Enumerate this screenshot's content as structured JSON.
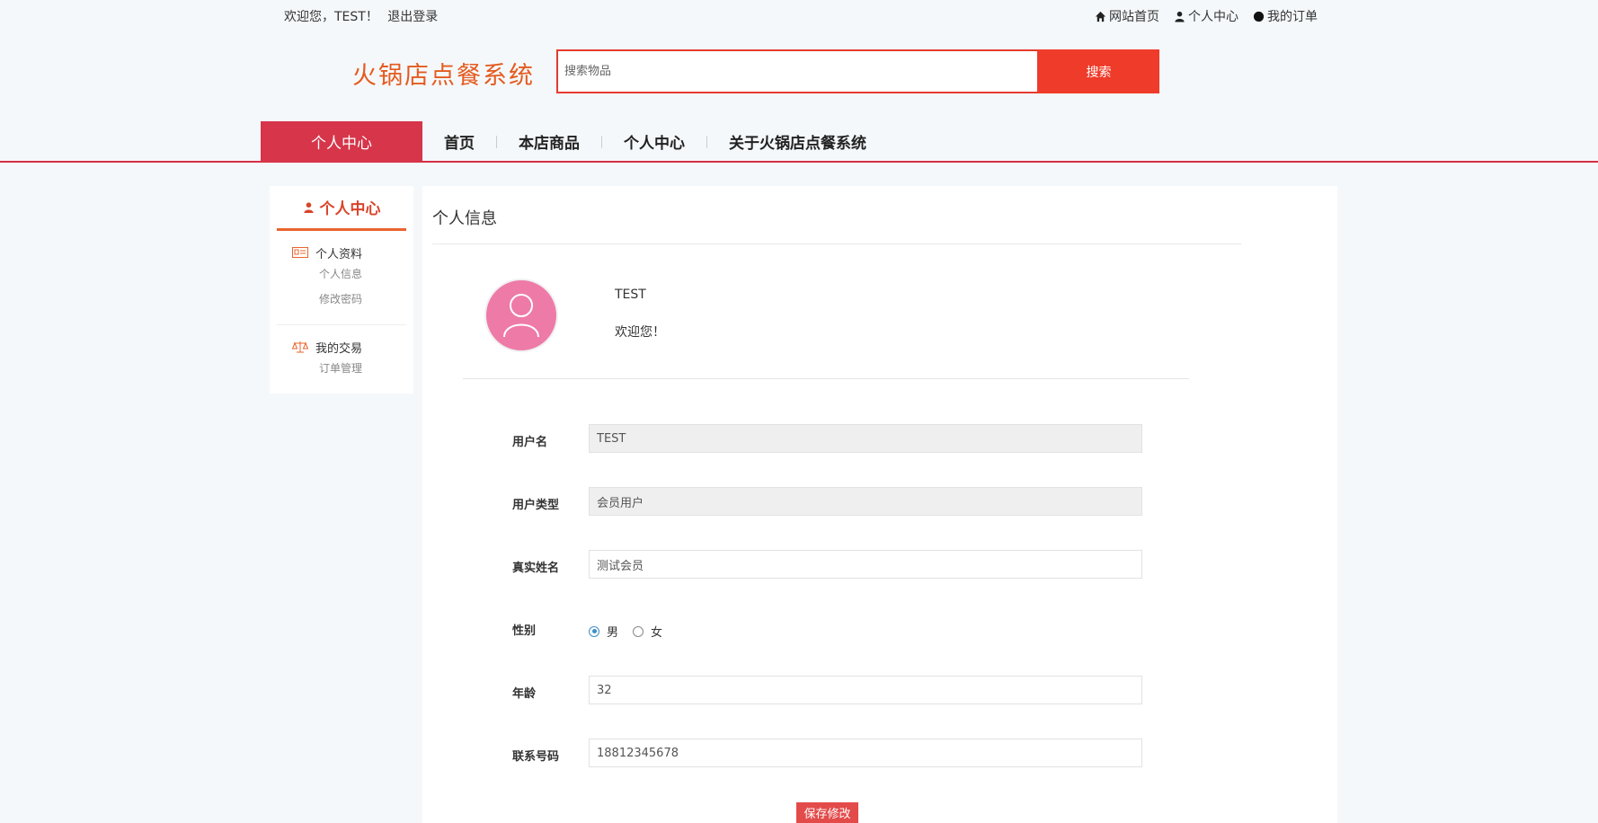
{
  "topbar": {
    "welcome": "欢迎您，TEST！",
    "logout": "退出登录",
    "links": [
      "网站首页",
      "个人中心",
      "我的订单"
    ]
  },
  "header": {
    "title": "火锅店点餐系统",
    "search_placeholder": "搜索物品",
    "search_button": "搜索"
  },
  "nav": {
    "active": "个人中心",
    "items": [
      "首页",
      "本店商品",
      "个人中心",
      "关于火锅店点餐系统"
    ]
  },
  "sidebar": {
    "title": "个人中心",
    "groups": [
      {
        "label": "个人资料",
        "items": [
          "个人信息",
          "修改密码"
        ]
      },
      {
        "label": "我的交易",
        "items": [
          "订单管理"
        ]
      }
    ]
  },
  "main": {
    "title": "个人信息",
    "profile": {
      "name": "TEST",
      "greeting": "欢迎您！"
    },
    "form": {
      "username_label": "用户名",
      "username_value": "TEST",
      "usertype_label": "用户类型",
      "usertype_value": "会员用户",
      "realname_label": "真实姓名",
      "realname_value": "测试会员",
      "gender_label": "性别",
      "gender_options": [
        "男",
        "女"
      ],
      "gender_selected": "男",
      "age_label": "年龄",
      "age_value": "32",
      "phone_label": "联系号码",
      "phone_value": "18812345678",
      "save_button": "保存修改"
    }
  },
  "colors": {
    "accent": "#d6354a",
    "search_red": "#ef3b2a",
    "title_orange": "#e45b1f",
    "avatar_pink": "#ee7aa8"
  }
}
